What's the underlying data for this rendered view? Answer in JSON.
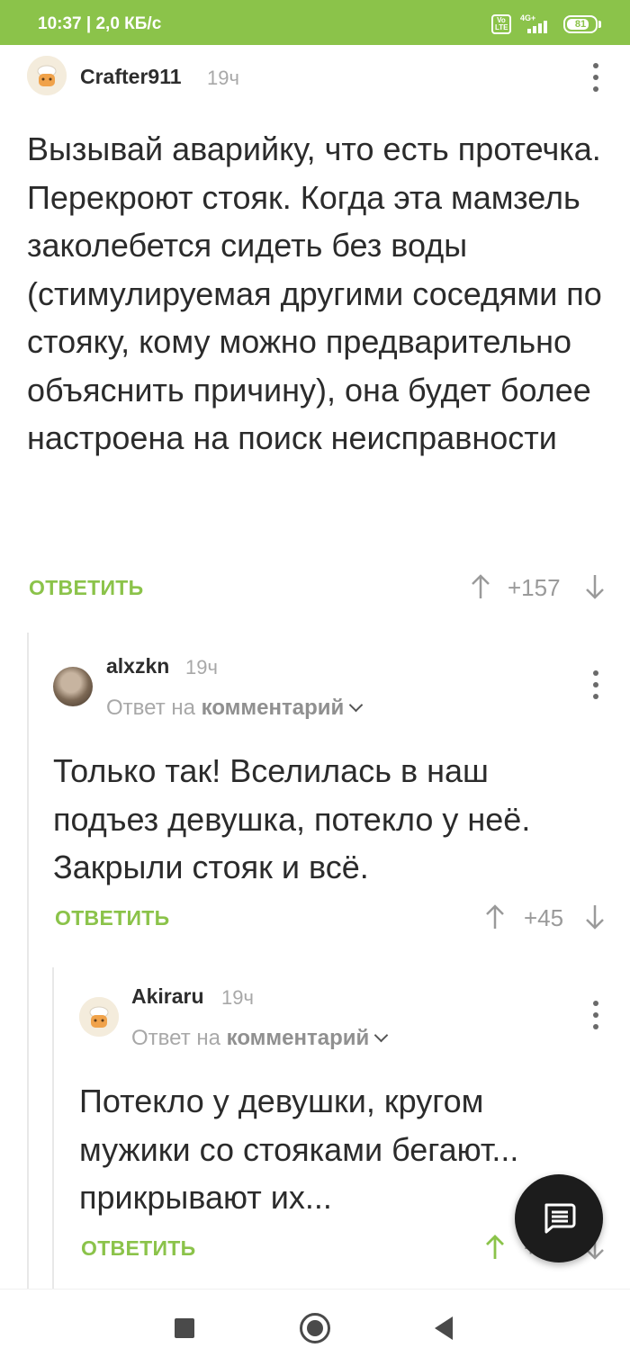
{
  "status_bar": {
    "time": "10:37 | 2,0 КБ/с",
    "volte_label": "Vo LTE",
    "network_label": "4G+",
    "battery_percent": "81"
  },
  "comments": [
    {
      "author": "Crafter911",
      "time": "19ч",
      "body": "Вызывай аварийку, что есть протечка. Перекроют стояк. Когда эта мамзель заколебется сидеть без воды (стимулируемая другими соседями по стояку, кому можно предварительно объяснить причину), она будет более настроена на поиск неисправности",
      "reply_label": "ОТВЕТИТЬ",
      "rating": "+157"
    },
    {
      "author": "alxzkn",
      "time": "19ч",
      "reply_to_prefix": "Ответ на",
      "reply_to_link": "комментарий",
      "body": "Только так! Вселилась в наш подъез девушка, потекло у неё. Закрыли стояк и всё.",
      "reply_label": "ОТВЕТИТЬ",
      "rating": "+45"
    },
    {
      "author": "Akiraru",
      "time": "19ч",
      "reply_to_prefix": "Ответ на",
      "reply_to_link": "комментарий",
      "body": "Потекло у девушки, кругом мужики со стояками бегают... прикрывают их...",
      "reply_label": "ОТВЕТИТЬ",
      "rating": "+"
    }
  ],
  "colors": {
    "accent": "#8bc34a",
    "upvote_active": "#8bc34a",
    "fab": "#1c1c1c"
  },
  "icons": [
    "more-vert-icon",
    "arrow-up-icon",
    "arrow-down-icon",
    "chevron-down-icon",
    "comment-fab-icon",
    "nav-recents-icon",
    "nav-home-icon",
    "nav-back-icon"
  ]
}
